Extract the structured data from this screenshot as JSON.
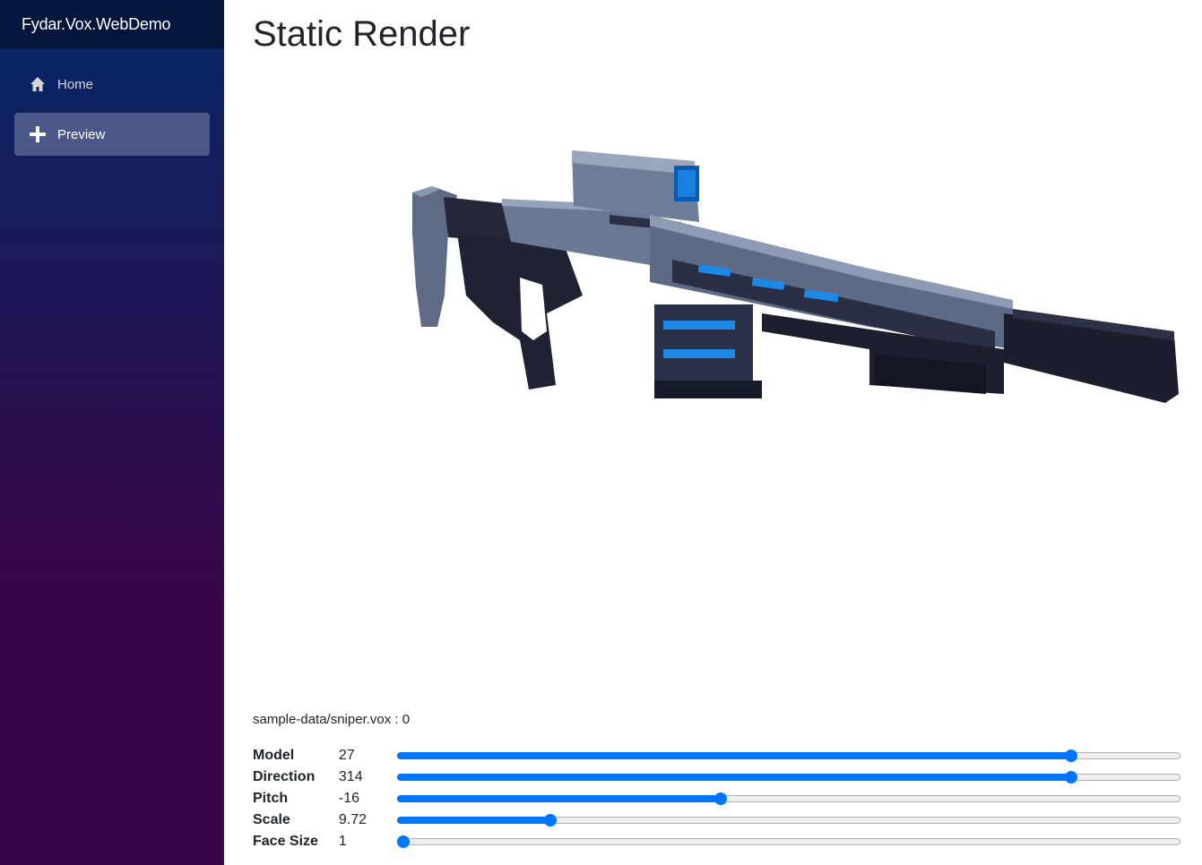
{
  "brand": {
    "title": "Fydar.Vox.WebDemo"
  },
  "nav": {
    "items": [
      {
        "label": "Home",
        "icon": "home-icon",
        "active": false
      },
      {
        "label": "Preview",
        "icon": "plus-icon",
        "active": true
      }
    ]
  },
  "page": {
    "title": "Static Render"
  },
  "file_line": "sample-data/sniper.vox : 0",
  "controls": [
    {
      "label": "Model",
      "value": "27",
      "fraction": 0.866
    },
    {
      "label": "Direction",
      "value": "314",
      "fraction": 0.866
    },
    {
      "label": "Pitch",
      "value": "-16",
      "fraction": 0.412
    },
    {
      "label": "Scale",
      "value": "9.72",
      "fraction": 0.191
    },
    {
      "label": "Face Size",
      "value": "1",
      "fraction": 0.0
    }
  ],
  "colors": {
    "accent": "#0075ff",
    "sidebar_top": "#052767",
    "sidebar_bottom": "#3a0647"
  }
}
